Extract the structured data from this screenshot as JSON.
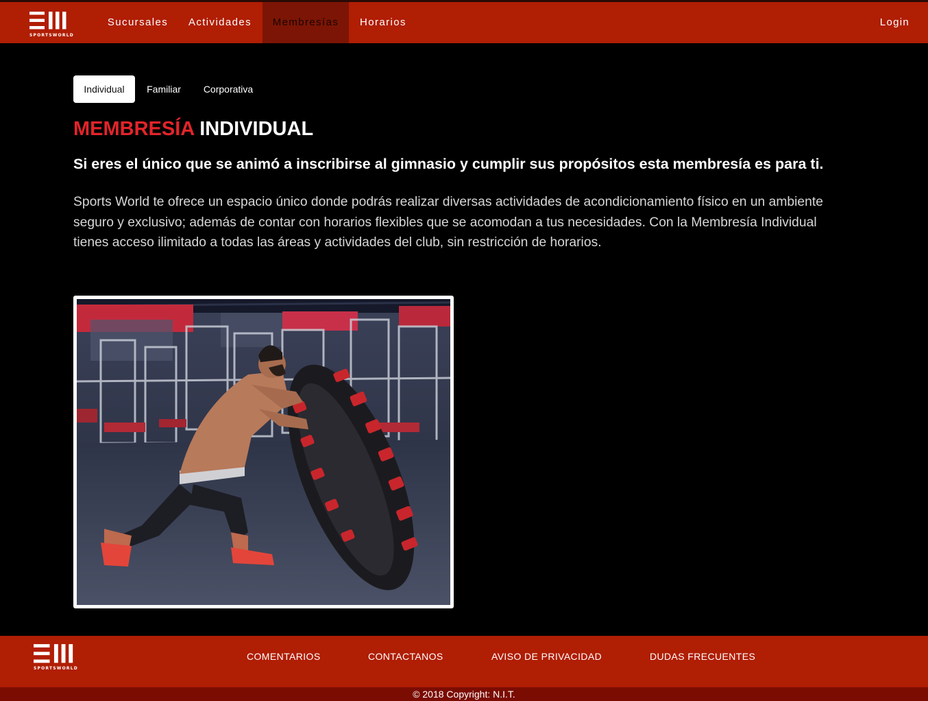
{
  "header": {
    "logo_text": "SPORTSWORLD",
    "nav": [
      {
        "label": "Sucursales",
        "active": false
      },
      {
        "label": "Actividades",
        "active": false
      },
      {
        "label": "Membresías",
        "active": true
      },
      {
        "label": "Horarios",
        "active": false
      }
    ],
    "login_label": "Login"
  },
  "tabs": [
    {
      "label": "Individual",
      "active": true
    },
    {
      "label": "Familiar",
      "active": false
    },
    {
      "label": "Corporativa",
      "active": false
    }
  ],
  "main": {
    "title_accent": "MEMBRESÍA",
    "title_rest": "INDIVIDUAL",
    "subtitle": "Si eres el único que se animó a inscribirse al gimnasio y cumplir sus propósitos esta membresía es para ti.",
    "description": "Sports World te ofrece un espacio único donde podrás realizar diversas actividades de acondicionamiento físico en un ambiente seguro y exclusivo; además de contar con horarios flexibles que se acomodan a tus necesidades. Con la Membresía Individual tienes acceso ilimitado a todas las áreas y actividades del club, sin restricción de horarios.",
    "image_alt": "gym tire flip photo"
  },
  "footer": {
    "logo_text": "SPORTSWORLD",
    "links": [
      "COMENTARIOS",
      "CONTACTANOS",
      "AVISO DE PRIVACIDAD",
      "DUDAS FRECUENTES"
    ],
    "copyright": "© 2018 Copyright: N.I.T."
  },
  "colors": {
    "brand_red": "#b01e04",
    "active_nav": "#7c1505",
    "accent_text": "#e2242a",
    "copyright_bar": "#7b0c02"
  }
}
